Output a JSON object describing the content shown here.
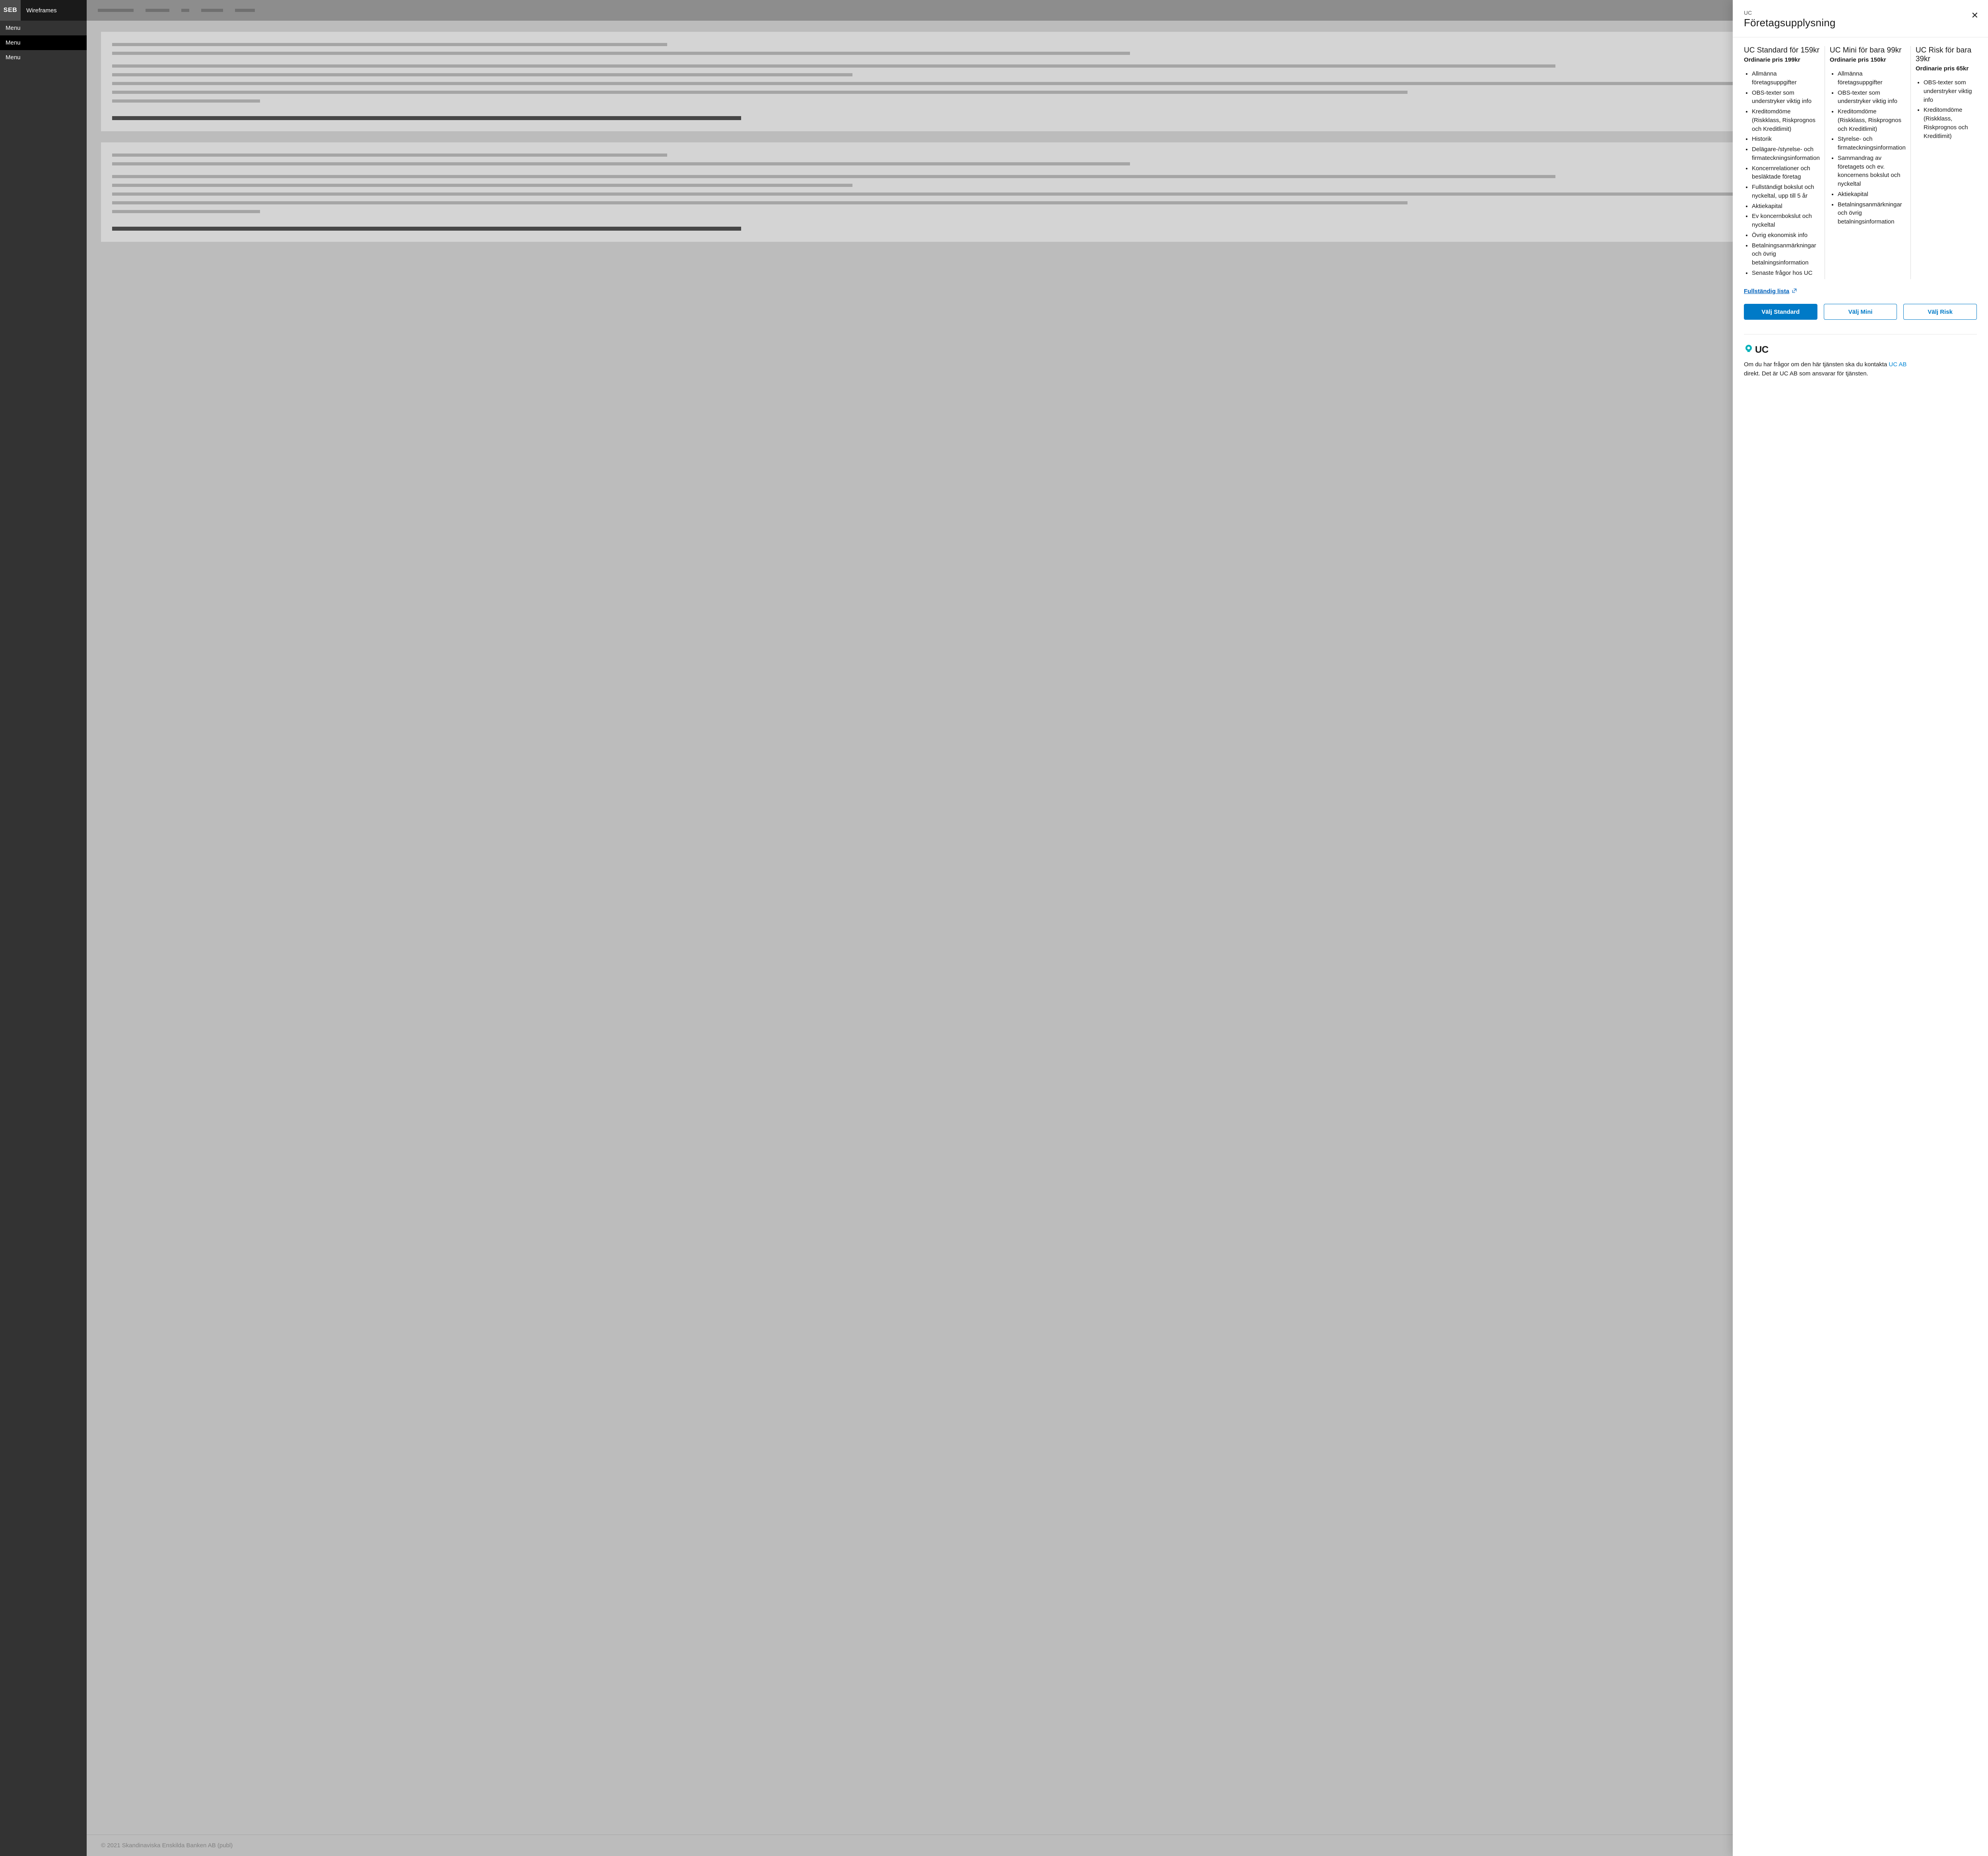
{
  "brand": {
    "logo": "SEB",
    "title": "Wireframes"
  },
  "sidebar": {
    "items": [
      {
        "label": "Menu"
      },
      {
        "label": "Menu"
      },
      {
        "label": "Menu"
      }
    ]
  },
  "footer": {
    "text": "© 2021 Skandinaviska Enskilda Banken AB (publ)"
  },
  "panel": {
    "eyebrow": "UC",
    "title": "Företagsupplysning",
    "full_list_label": "Fullständig lista",
    "plans": [
      {
        "title": "UC Standard för 159kr",
        "subprice": "Ordinarie pris 199kr",
        "cta": "Välj Standard",
        "features": [
          "Allmänna företagsuppgifter",
          "OBS-texter som understryker viktig info",
          "Kreditomdöme (Riskklass, Riskprognos och Kreditlimit)",
          "Historik",
          "Delägare-/styrelse- och firmateckningsinformation",
          "Koncernrelationer och besläktade företag",
          "Fullständigt bokslut och nyckeltal, upp till 5 år",
          "Aktiekapital",
          "Ev koncernbokslut och nyckeltal",
          "Övrig ekonomisk info",
          "Betalningsanmärkningar och övrig betalningsinformation",
          "Senaste frågor hos UC"
        ]
      },
      {
        "title": "UC Mini för bara 99kr",
        "subprice": "Ordinarie pris 150kr",
        "cta": "Välj Mini",
        "features": [
          "Allmänna företagsuppgifter",
          "OBS-texter som understryker viktig info",
          "Kreditomdöme (Riskklass, Riskprognos och Kreditlimit)",
          "Styrelse- och firmateckningsinformation",
          "Sammandrag av företagets och ev. koncernens bokslut och nyckeltal",
          "Aktiekapital",
          "Betalningsanmärkningar och övrig betalningsinformation"
        ]
      },
      {
        "title": "UC Risk för bara 39kr",
        "subprice": "Ordinarie pris 65kr",
        "cta": "Välj Risk",
        "features": [
          "OBS-texter som understryker viktig info",
          "Kreditomdöme (Riskklass, Riskprognos och Kreditlimit)"
        ]
      }
    ],
    "contact": {
      "text_before": "Om du har frågor om den här tjänsten ska du kontakta ",
      "link_text": "UC AB",
      "text_after": " direkt. Det är UC AB som ansvarar för tjänsten."
    }
  }
}
